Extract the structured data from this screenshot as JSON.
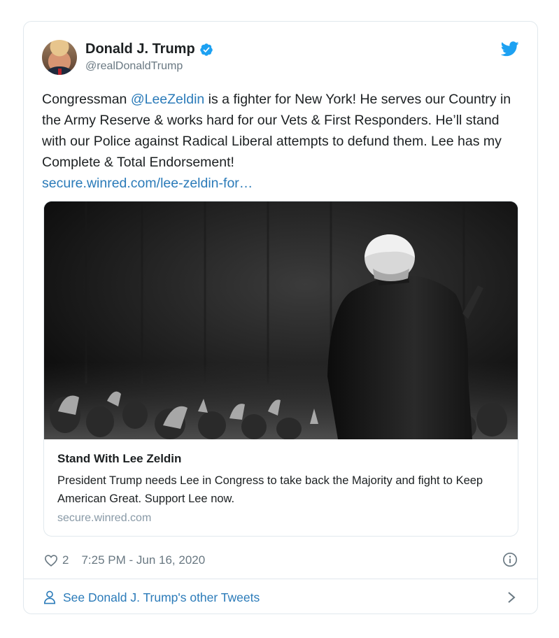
{
  "author": {
    "name": "Donald J. Trump",
    "handle": "@realDonaldTrump"
  },
  "tweet": {
    "text_before": "Congressman ",
    "mention": "@LeeZeldin",
    "text_after": " is a fighter for New York! He serves our Country in the Army Reserve & works hard for our Vets & First Responders. He’ll stand with our Police against Radical Liberal attempts to defund them. Lee has my Complete & Total Endorsement!",
    "link": "secure.winred.com/lee-zeldin-for…"
  },
  "card": {
    "title": "Stand With Lee Zeldin",
    "description": "President Trump needs Lee in Congress to take back the Majority and fight to Keep American Great. Support Lee now.",
    "domain": "secure.winred.com"
  },
  "meta": {
    "like_count": "2",
    "timestamp": "7:25 PM - Jun 16, 2020"
  },
  "footer": {
    "link": "See Donald J. Trump's other Tweets"
  },
  "icons": {
    "verified": "verified-badge-icon",
    "brand": "twitter-bird-icon",
    "like": "heart-icon",
    "info": "info-icon",
    "profile": "person-icon",
    "more": "chevron-right-icon"
  },
  "colors": {
    "link": "#2b7bb9",
    "twitter_blue": "#1da1f2",
    "secondary_text": "#697882",
    "border": "#e1e8ed"
  }
}
